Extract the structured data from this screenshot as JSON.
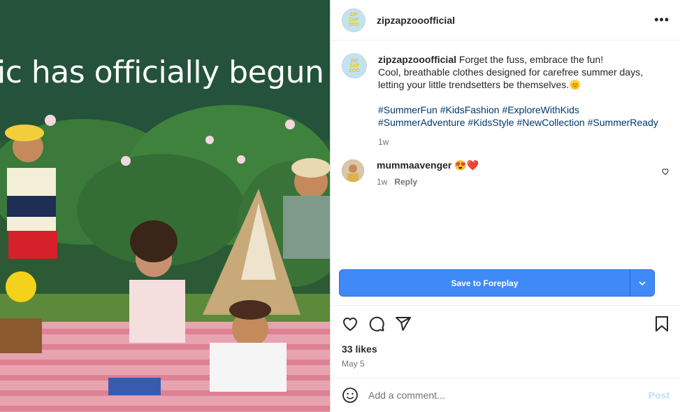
{
  "post": {
    "overlay_text": "ic has officially begun",
    "username": "zipzapzooofficial",
    "caption_line1": "Forget the fuss, embrace the fun!",
    "caption_line2": "Cool, breathable clothes designed for carefree summer days,",
    "caption_line3": "letting your little trendsetters be themselves.",
    "caption_emoji": "🌞",
    "hashtags": [
      "#SummerFun",
      "#KidsFashion",
      "#ExploreWithKids",
      "#SummerAdventure",
      "#KidsStyle",
      "#NewCollection",
      "#SummerReady"
    ],
    "caption_time": "1w",
    "likes": "33 likes",
    "date": "May 5"
  },
  "comment": {
    "username": "mummaavenger",
    "emoji": "😍❤️",
    "time": "1w",
    "reply_label": "Reply"
  },
  "save": {
    "label": "Save to Foreplay"
  },
  "add_comment": {
    "placeholder": "Add a comment...",
    "post_label": "Post"
  },
  "colors": {
    "accent": "#3f8af7",
    "link": "#00376b",
    "muted": "#737373"
  },
  "icons": [
    "more-icon",
    "heart-icon",
    "comment-icon",
    "share-icon",
    "bookmark-icon",
    "emoji-icon",
    "chevron-down-icon"
  ]
}
